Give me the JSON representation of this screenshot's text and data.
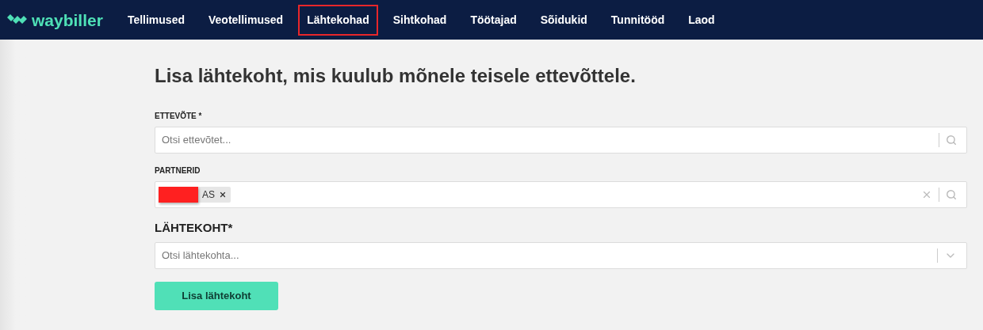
{
  "brand": "waybiller",
  "nav": [
    {
      "label": "Tellimused",
      "selected": false
    },
    {
      "label": "Veotellimused",
      "selected": false
    },
    {
      "label": "Lähtekohad",
      "selected": true
    },
    {
      "label": "Sihtkohad",
      "selected": false
    },
    {
      "label": "Töötajad",
      "selected": false
    },
    {
      "label": "Sõidukid",
      "selected": false
    },
    {
      "label": "Tunnitööd",
      "selected": false
    },
    {
      "label": "Laod",
      "selected": false
    }
  ],
  "heading": "Lisa lähtekoht, mis kuulub mõnele teisele ettevõttele.",
  "fields": [
    {
      "kind": "search",
      "label": "ETTEVÕTE *",
      "placeholder": "Otsi ettevõtet..."
    },
    {
      "kind": "multi",
      "label": "PARTNERID",
      "tags": [
        {
          "text": "AS",
          "redacted": true
        }
      ]
    },
    {
      "kind": "select",
      "label": "LÄHTEKOHT*",
      "placeholder": "Otsi lähtekohta..."
    }
  ],
  "submit": "Lisa lähtekoht"
}
